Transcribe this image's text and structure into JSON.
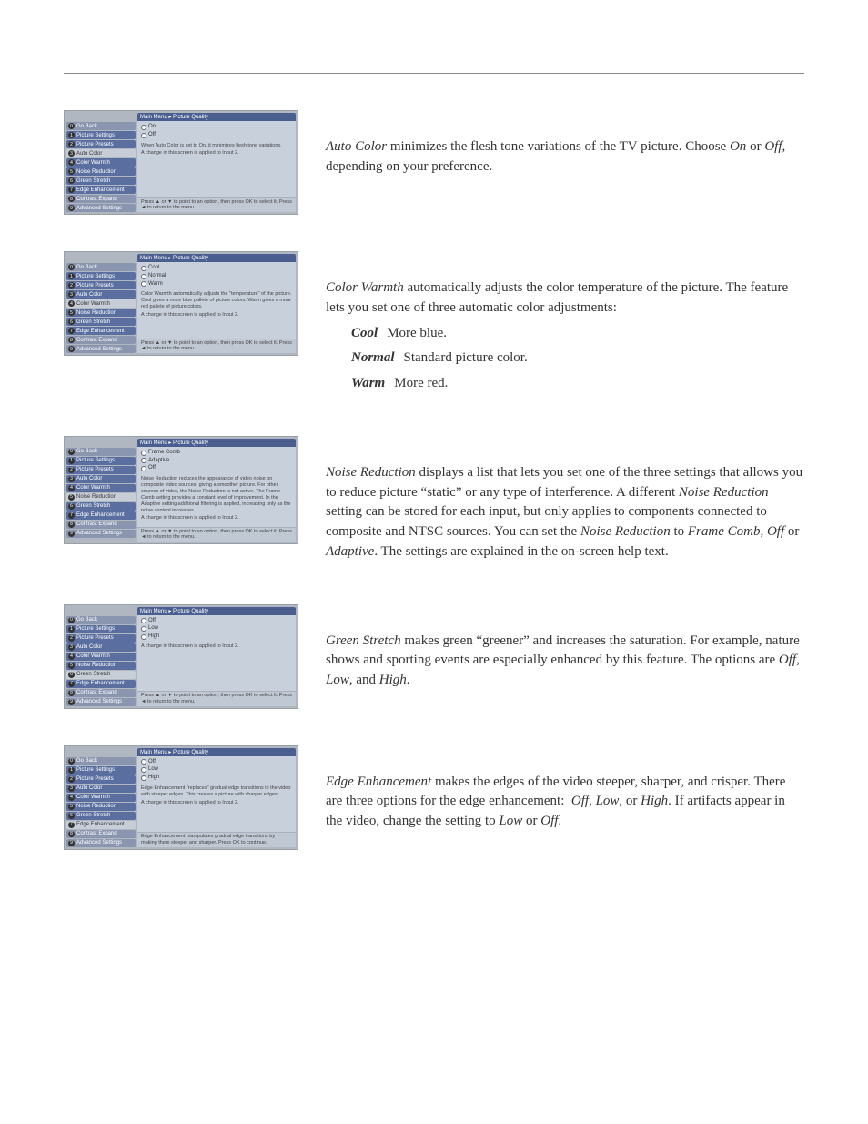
{
  "breadcrumb": "Main Menu ▸ Picture Quality",
  "applied_text": "A change in this screen is applied to Input 2.",
  "footer_text_generic": "Press ▲ or ▼ to point to an option, then press OK to select it. Press ◄ to return to the menu.",
  "sidebar_items": [
    {
      "n": "0",
      "label": "Go Back"
    },
    {
      "n": "1",
      "label": "Picture Settings"
    },
    {
      "n": "2",
      "label": "Picture Presets"
    },
    {
      "n": "3",
      "label": "Auto Color"
    },
    {
      "n": "4",
      "label": "Color Warmth"
    },
    {
      "n": "5",
      "label": "Noise Reduction"
    },
    {
      "n": "6",
      "label": "Green Stretch"
    },
    {
      "n": "7",
      "label": "Edge Enhancement"
    },
    {
      "n": "8",
      "label": "Contrast Expand"
    },
    {
      "n": "9",
      "label": "Advanced Settings"
    }
  ],
  "sections": [
    {
      "selected_index": 3,
      "options": [
        "On",
        "Off"
      ],
      "panel_note": "When Auto Color is set to On, it minimizes flesh tone variations.",
      "footer": "Press ▲ or ▼ to point to an option, then press OK to select it. Press ◄ to return to the menu.",
      "desc_html": "<span class='term'>Auto Color</span> minimizes the flesh tone variations of the TV picture. Choose <span class='term'>On</span> or <span class='term'>Off</span>, depending on your preference."
    },
    {
      "selected_index": 4,
      "options": [
        "Cool",
        "Normal",
        "Warm"
      ],
      "panel_note": "Color Warmth automatically adjusts the \"temperature\" of the picture. Cool gives a more blue pallete of picture colors. Warm gives a more red pallete of picture colors.",
      "footer": "Press ▲ or ▼ to point to an option, then press OK to select it. Press ◄ to return to the menu.",
      "desc_html": "<span class='term'>Color Warmth</span> automatically adjusts the color temperature of the picture. The feature lets you set one of three automatic color adjustments:",
      "defs": [
        {
          "k": "Cool",
          "v": "More blue."
        },
        {
          "k": "Normal",
          "v": "Standard picture color."
        },
        {
          "k": "Warm",
          "v": "More red."
        }
      ]
    },
    {
      "selected_index": 5,
      "options": [
        "Frame Comb",
        "Adaptive",
        "Off"
      ],
      "panel_note": "Noise Reduction reduces the appearance of video noise on composite video sources, giving a smoother picture. For other sources of video, the Noise Reduction is not active.\n\nThe Frame Comb setting provides a constant level of improvement. In the Adaptive setting additional filtering is applied, increasing only as the noise content increases.",
      "footer": "Press ▲ or ▼ to point to an option, then press OK to select it. Press ◄ to return to the menu.",
      "desc_html": "<span class='term'>Noise Reduction</span> displays a list that lets you set one of the three settings that allows you to reduce picture “static” or any type of interference. A different <span class='term'>Noise Reduction</span> setting can be stored for each input, but only applies to components connected to composite and NTSC sources. You can set the <span class='term'>Noise Reduction</span> to <span class='term'>Frame Comb</span>, <span class='term'>Off</span> or <span class='term'>Adaptive</span>. The settings are explained in the on-screen help text."
    },
    {
      "selected_index": 6,
      "options": [
        "Off",
        "Low",
        "High"
      ],
      "panel_note": "",
      "footer": "Press ▲ or ▼ to point to an option, then press OK to select it. Press ◄ to return to the menu.",
      "desc_html": "<span class='term'>Green Stretch</span> makes green “greener” and increases the saturation. For example, nature shows and sporting events are especially enhanced by this feature. The options are <span class='term'>Off</span>, <span class='term'>Low</span>, and <span class='term'>High</span>."
    },
    {
      "selected_index": 7,
      "options": [
        "Off",
        "Low",
        "High"
      ],
      "panel_note": "Edge Enhancement \"replaces\" gradual edge transitions in the video with steeper edges. This creates a picture with sharper edges.",
      "footer": "Edge Enhancement manipulates gradual edge transitions by making them steeper and sharper. Press OK to continue.",
      "desc_html": "<span class='term'>Edge Enhancement</span> makes the edges of the video steeper, sharper, and crisper. There are three options for the edge enhancement:&nbsp; <span class='term'>Off</span>, <span class='term'>Low</span>, or <span class='term'>High</span>. If artifacts appear in the video, change the setting to <span class='term'>Low</span> or <span class='term'>Off</span>."
    }
  ]
}
